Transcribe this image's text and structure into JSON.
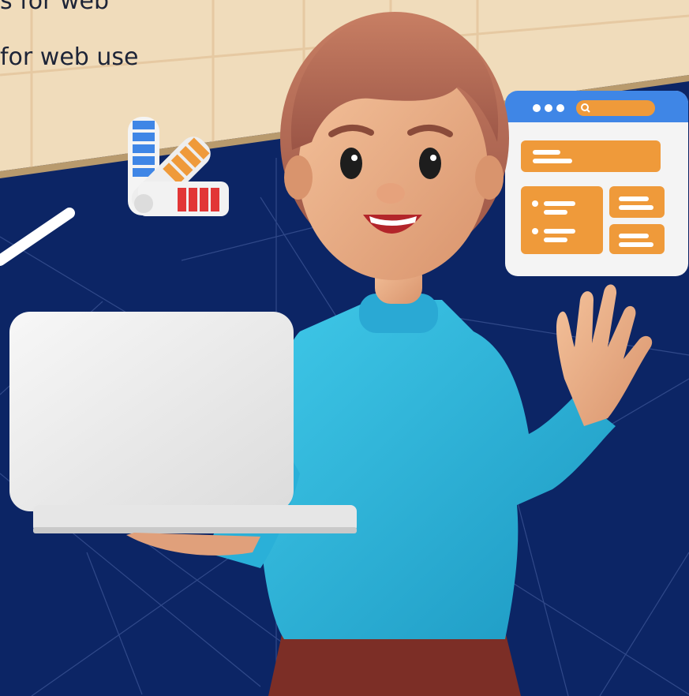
{
  "captions": {
    "line1": "s for web",
    "line2": "for web use"
  },
  "illustration": {
    "subject": "3d-woman-waving-holding-laptop",
    "props": [
      "color-swatch-fan",
      "browser-window-mockup",
      "laptop"
    ],
    "icons": [
      "search-icon",
      "window-dots-icon"
    ]
  },
  "colors": {
    "navy_background": "#0c2565",
    "beige_panel": "#f0dcbb",
    "sweater": "#2ab7db",
    "accent_orange": "#ef9a3a",
    "browser_blue": "#3f86e6",
    "swatch_red": "#e23636"
  }
}
